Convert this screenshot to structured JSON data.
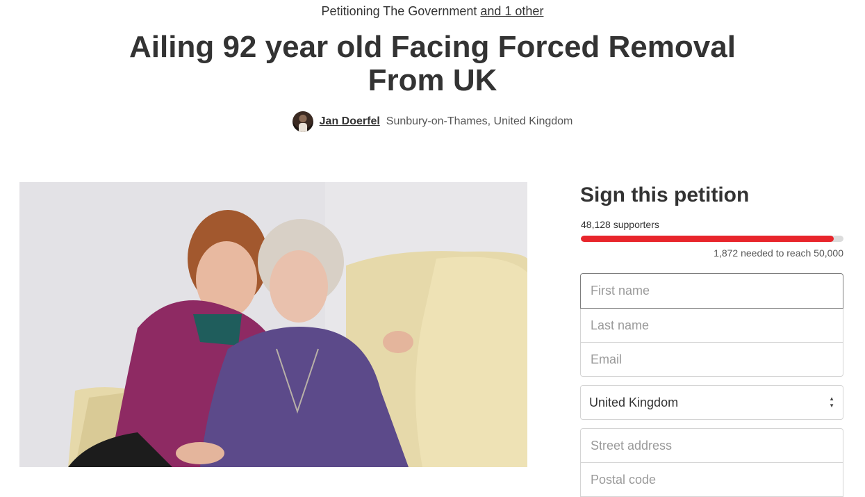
{
  "header": {
    "petitioning_prefix": "Petitioning The Government",
    "petitioning_link": "and 1 other",
    "title_line1": "Ailing 92 year old Facing Forced Removal",
    "title_line2": "From UK",
    "author_name": "Jan Doerfel",
    "author_location": "Sunbury-on-Thames, United Kingdom"
  },
  "sign": {
    "title": "Sign this petition",
    "supporters": "48,128 supporters",
    "progress_fraction": 0.96256,
    "needed": "1,872 needed to reach 50,000",
    "country": "United Kingdom"
  },
  "form": {
    "first_name_placeholder": "First name",
    "last_name_placeholder": "Last name",
    "email_placeholder": "Email",
    "street_placeholder": "Street address",
    "postal_placeholder": "Postal code"
  },
  "colors": {
    "progress": "#e8252b",
    "progress_track": "#dcdcdc",
    "text": "#333333"
  }
}
